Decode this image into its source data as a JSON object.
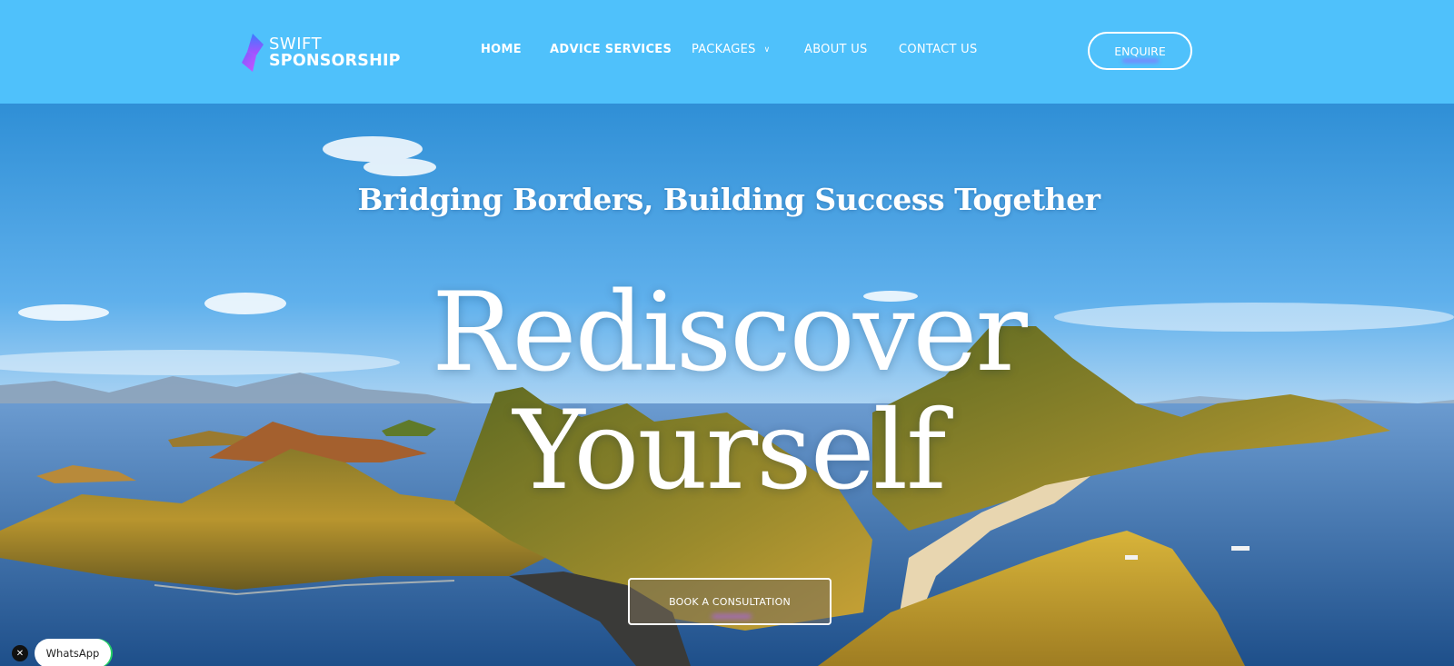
{
  "header": {
    "logo": {
      "line1": "SWIFT",
      "line2": "SPONSORSHIP",
      "icon": "brand-ribbon-icon",
      "gradient": [
        "#3b7bff",
        "#b04dff"
      ]
    },
    "nav": [
      {
        "label": "HOME",
        "bold": true
      },
      {
        "label": "ADVICE SERVICES",
        "bold": true
      },
      {
        "label": "PACKAGES",
        "bold": false,
        "has_dropdown": true,
        "dropdown_icon": "chevron-down-icon"
      },
      {
        "label": "ABOUT US",
        "bold": false
      },
      {
        "label": "CONTACT US",
        "bold": false
      }
    ],
    "enquire_label": "ENQUIRE",
    "background": "#4fc1fb"
  },
  "hero": {
    "tagline": "Bridging Borders, Building Success Together",
    "headline_line1": "Rediscover",
    "headline_line2": "Yourself",
    "cta_label": "BOOK A CONSULTATION",
    "background_description_icon": "island-landscape-image"
  },
  "whatsapp": {
    "label": "WhatsApp",
    "close_icon": "close-icon",
    "close_glyph": "✕",
    "accent": "#25d366"
  }
}
